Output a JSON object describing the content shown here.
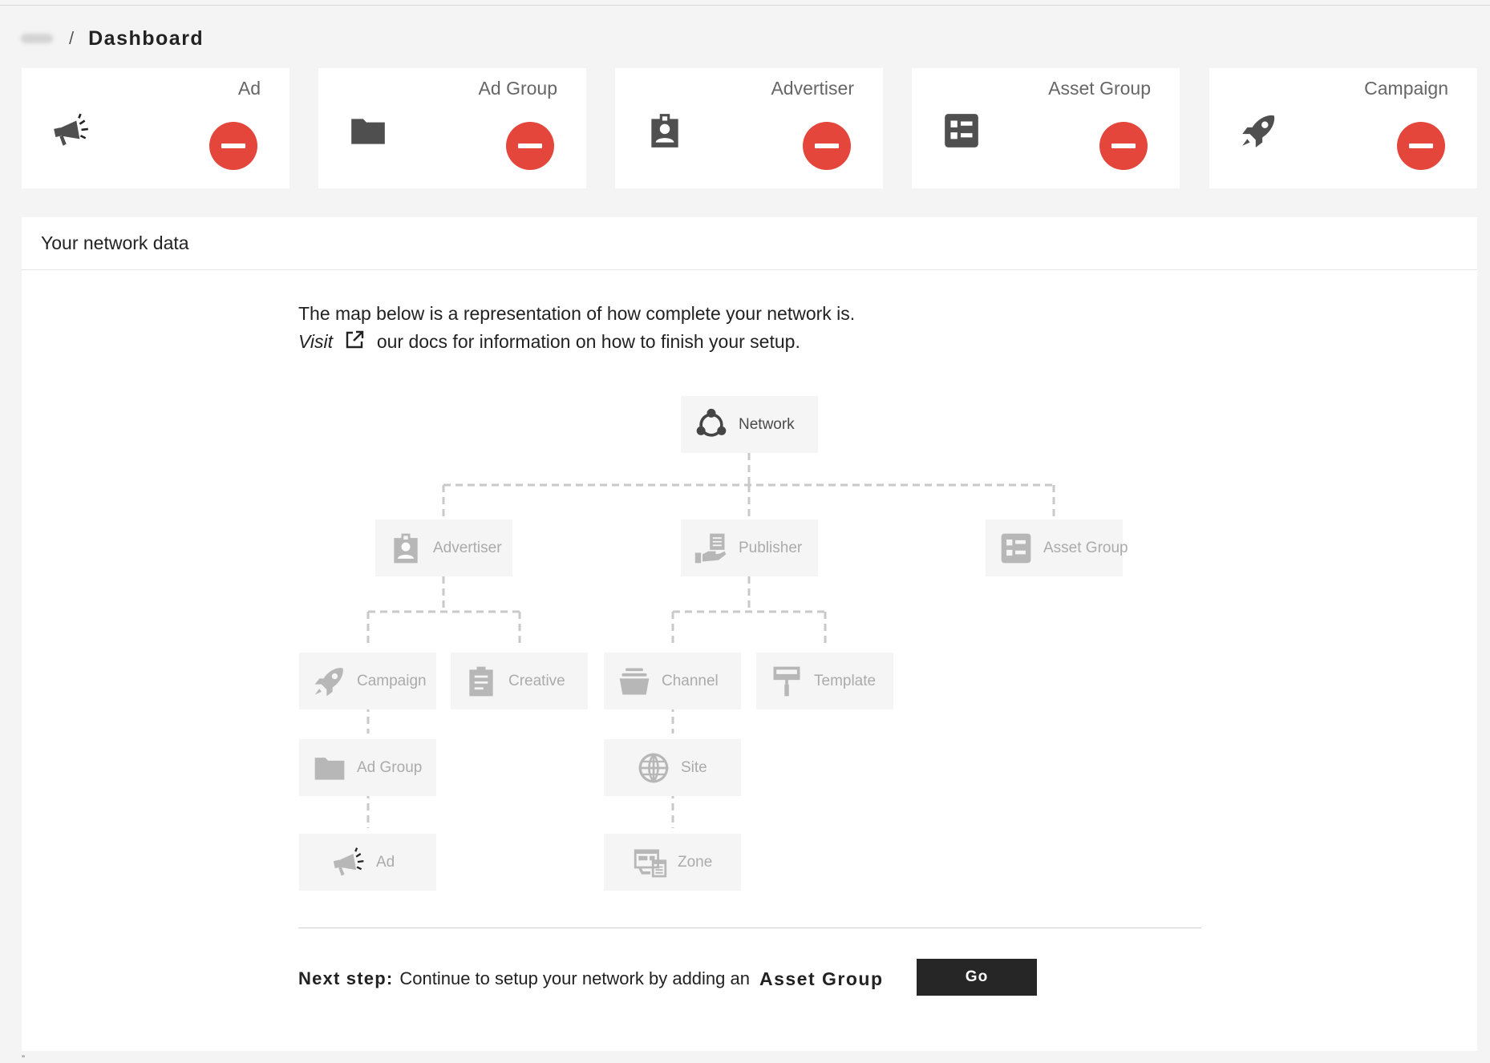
{
  "breadcrumb": {
    "current": "Dashboard",
    "separator": "/"
  },
  "cards": [
    {
      "label": "Ad",
      "icon": "megaphone-icon",
      "status": "missing"
    },
    {
      "label": "Ad Group",
      "icon": "folder-icon",
      "status": "missing"
    },
    {
      "label": "Advertiser",
      "icon": "badge-icon",
      "status": "missing"
    },
    {
      "label": "Asset Group",
      "icon": "list-icon",
      "status": "missing"
    },
    {
      "label": "Campaign",
      "icon": "rocket-icon",
      "status": "missing"
    }
  ],
  "panel": {
    "title": "Your network data",
    "intro_line1": "The map below is a representation of how complete your network is.",
    "intro_visit": "Visit",
    "intro_line2": "our docs for information on how to finish your setup."
  },
  "tree": {
    "network": {
      "label": "Network",
      "icon": "network-icon",
      "active": true
    },
    "advertiser": {
      "label": "Advertiser",
      "icon": "badge-icon"
    },
    "publisher": {
      "label": "Publisher",
      "icon": "hand-document-icon"
    },
    "asset_group": {
      "label": "Asset Group",
      "icon": "list-icon"
    },
    "campaign": {
      "label": "Campaign",
      "icon": "rocket-icon"
    },
    "creative": {
      "label": "Creative",
      "icon": "clipboard-icon"
    },
    "channel": {
      "label": "Channel",
      "icon": "stack-icon"
    },
    "template": {
      "label": "Template",
      "icon": "paint-roller-icon"
    },
    "ad_group": {
      "label": "Ad Group",
      "icon": "folder-icon"
    },
    "site": {
      "label": "Site",
      "icon": "globe-icon"
    },
    "ad": {
      "label": "Ad",
      "icon": "megaphone-icon"
    },
    "zone": {
      "label": "Zone",
      "icon": "layout-icon"
    }
  },
  "next_step": {
    "label": "Next step:",
    "text": "Continue to setup your network by adding an",
    "entity": "Asset Group",
    "button": "Go"
  },
  "footer_mark": "”",
  "colors": {
    "status_missing": "#e4463c",
    "button_dark": "#262626"
  }
}
